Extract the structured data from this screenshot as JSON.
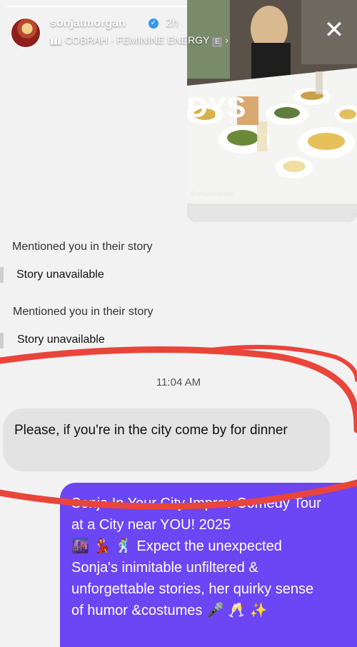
{
  "header": {
    "username": "sonjatmorgan",
    "time_ago": "2h",
    "music": "COBRAH · FEMININE ENERGY",
    "explicit_badge": "E"
  },
  "photo": {
    "overlay_text": "DYS",
    "watermark": "@sonjatmorgan"
  },
  "messages": [
    {
      "mention": "Mentioned you in their story",
      "status": "Story unavailable"
    },
    {
      "mention": "Mentioned you in their story",
      "status": "Story unavailable"
    }
  ],
  "timestamp": "11:04 AM",
  "incoming_message": "Please, if you're in the city come by for dinner",
  "outgoing_message": "Sonja In Your City Improv Comedy Tour\nat a City near YOU! 2025\n🌆 💃 🕺 Expect the unexpected\nSonja's inimitable unfiltered &\nunforgettable stories, her quirky sense\nof humor &costumes 🎤 🥂 ✨",
  "colors": {
    "accent_purple": "#6c45f5",
    "annotation_red": "#e9453a",
    "incoming_bubble": "#e3e3e3",
    "verified_blue": "#3897f0"
  }
}
